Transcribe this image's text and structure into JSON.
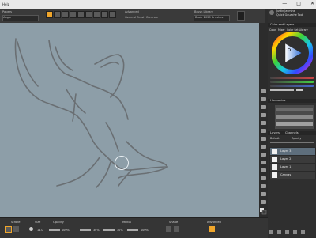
{
  "menubar": {
    "menu_help": "Help",
    "minimize_glyph": "—",
    "maximize_glyph": "□",
    "close_glyph": "✕"
  },
  "toolbar": {
    "papers_label": "Papers",
    "blend_mode_label": "Angle",
    "advanced_label": "Advanced",
    "general_brush_controls_label": "General Brush Controls",
    "brush_library_label": "Brush Library",
    "brush_library_value": "Basic 2020 Brushes",
    "user_label": "Justin Jasmine",
    "brush_name": "Quick Gouache Tool"
  },
  "panels": {
    "color_title": "Color and Layers",
    "color_tab_1": "Color",
    "color_tab_2": "Mixer",
    "color_tab_3": "Color Set Library",
    "harmonies_title": "Harmonies",
    "layers_title": "Layers",
    "layers_tab": "Channels",
    "blend_label": "Default",
    "opacity_label": "Opacity",
    "layers": [
      {
        "name": "Layer 3",
        "selected": true
      },
      {
        "name": "Layer 2",
        "selected": false
      },
      {
        "name": "Layer 1",
        "selected": false
      },
      {
        "name": "Canvas",
        "selected": false
      }
    ]
  },
  "bottombar": {
    "stroke_label": "Stroke",
    "size_label": "Size",
    "opacity_label": "Opacity",
    "media_label": "Media",
    "shape_label": "Shape",
    "advanced_label": "Advanced",
    "size_value": "14.0",
    "opacity_value": "100%",
    "grain_value": "30%",
    "resat_value": "30%",
    "bleed_value": "100%"
  },
  "colors": {
    "canvas_bg": "#8d9ea8",
    "sketch_stroke": "#6a6f73",
    "accent": "#f0a62b"
  }
}
